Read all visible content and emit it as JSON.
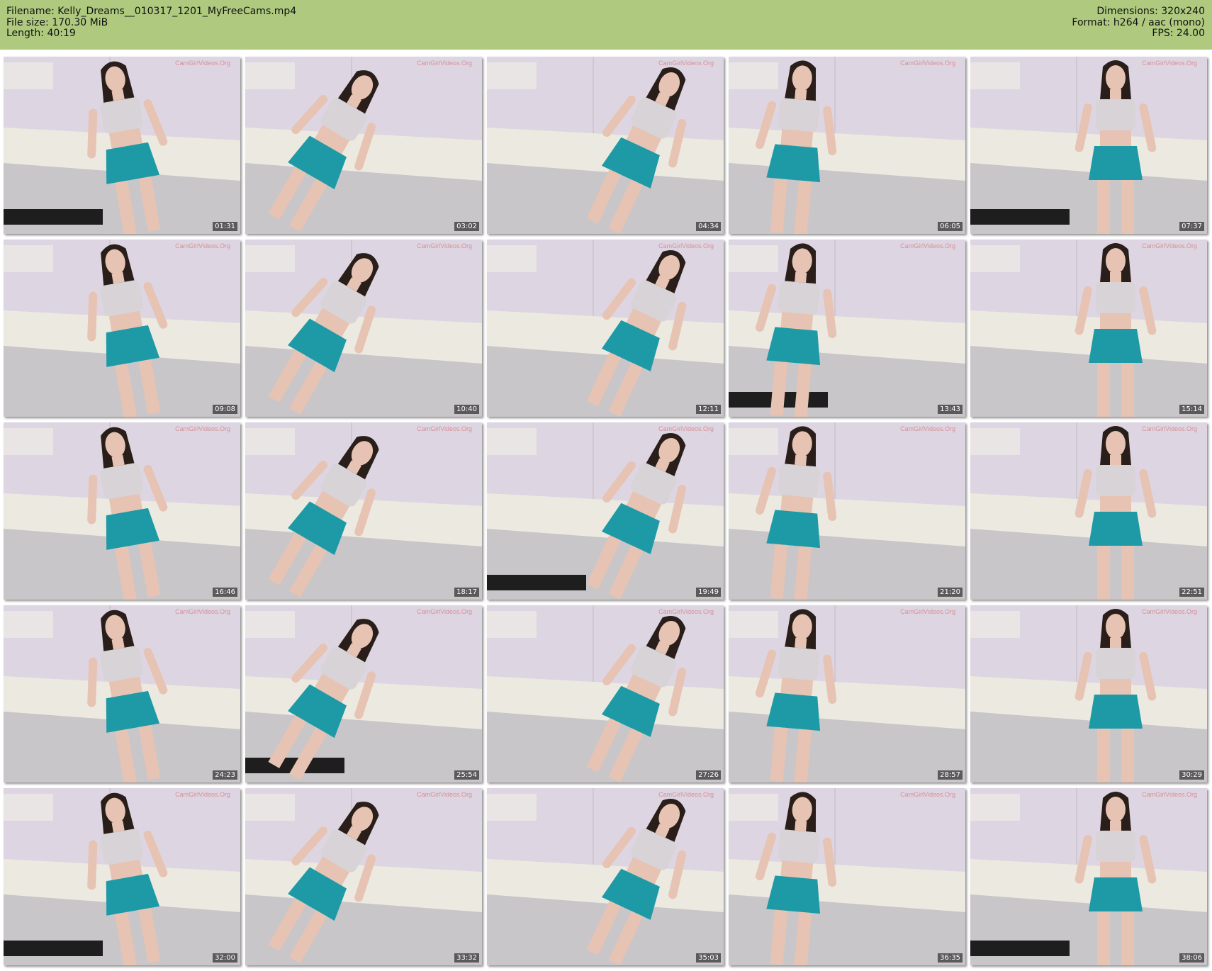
{
  "header": {
    "filename": "Filename: Kelly_Dreams__010317_1201_MyFreeCams.mp4",
    "filesize": "File size: 170.30 MiB",
    "length": "Length: 40:19",
    "dimensions": "Dimensions: 320x240",
    "format": "Format: h264 / aac (mono)",
    "fps": "FPS: 24.00"
  },
  "colors": {
    "header_bg": "#afca7f",
    "wall": "#d9d3dc",
    "skirt": "#1e9aa6",
    "top": "#d7d3d6",
    "hair": "#2a1e1a",
    "skin": "#e7c3b3"
  },
  "thumbnails": [
    {
      "time": "01:31"
    },
    {
      "time": "03:02"
    },
    {
      "time": "04:34"
    },
    {
      "time": "06:05"
    },
    {
      "time": "07:37"
    },
    {
      "time": "09:08"
    },
    {
      "time": "10:40"
    },
    {
      "time": "12:11"
    },
    {
      "time": "13:43"
    },
    {
      "time": "15:14"
    },
    {
      "time": "16:46"
    },
    {
      "time": "18:17"
    },
    {
      "time": "19:49"
    },
    {
      "time": "21:20"
    },
    {
      "time": "22:51"
    },
    {
      "time": "24:23"
    },
    {
      "time": "25:54"
    },
    {
      "time": "27:26"
    },
    {
      "time": "28:57"
    },
    {
      "time": "30:29"
    },
    {
      "time": "32:00"
    },
    {
      "time": "33:32"
    },
    {
      "time": "35:03"
    },
    {
      "time": "36:35"
    },
    {
      "time": "38:06"
    }
  ]
}
